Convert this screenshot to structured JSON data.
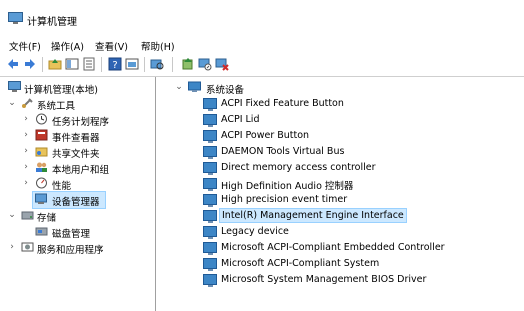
{
  "window": {
    "title": "计算机管理"
  },
  "menu": [
    "文件(F)",
    "操作(A)",
    "查看(V)",
    "帮助(H)"
  ],
  "toolbar": {
    "icons": [
      "back-icon",
      "forward-icon",
      "up-folder-icon",
      "show-hide-tree-icon",
      "properties-icon",
      "help-icon",
      "console-icon",
      "scan-hardware-icon",
      "update-driver-icon",
      "disable-device-icon",
      "uninstall-device-icon"
    ]
  },
  "tree": {
    "root": "计算机管理(本地)",
    "system_tools": "系统工具",
    "task_scheduler": "任务计划程序",
    "event_viewer": "事件查看器",
    "shared_folders": "共享文件夹",
    "local_users": "本地用户和组",
    "performance": "性能",
    "device_manager": "设备管理器",
    "storage": "存储",
    "disk_management": "磁盘管理",
    "services_apps": "服务和应用程序"
  },
  "devices": {
    "category": "系统设备",
    "items": [
      "ACPI Fixed Feature Button",
      "ACPI Lid",
      "ACPI Power Button",
      "DAEMON Tools Virtual Bus",
      "Direct memory access controller",
      "High Definition Audio 控制器",
      "High precision event timer",
      "Intel(R) Management Engine Interface",
      "Legacy device",
      "Microsoft ACPI-Compliant Embedded Controller",
      "Microsoft ACPI-Compliant System",
      "Microsoft System Management BIOS Driver"
    ],
    "selected_index": 7
  },
  "colors": {
    "selection_bg": "#cce8ff",
    "selection_border": "#99d1ff",
    "device_icon": "#3d86c6"
  }
}
